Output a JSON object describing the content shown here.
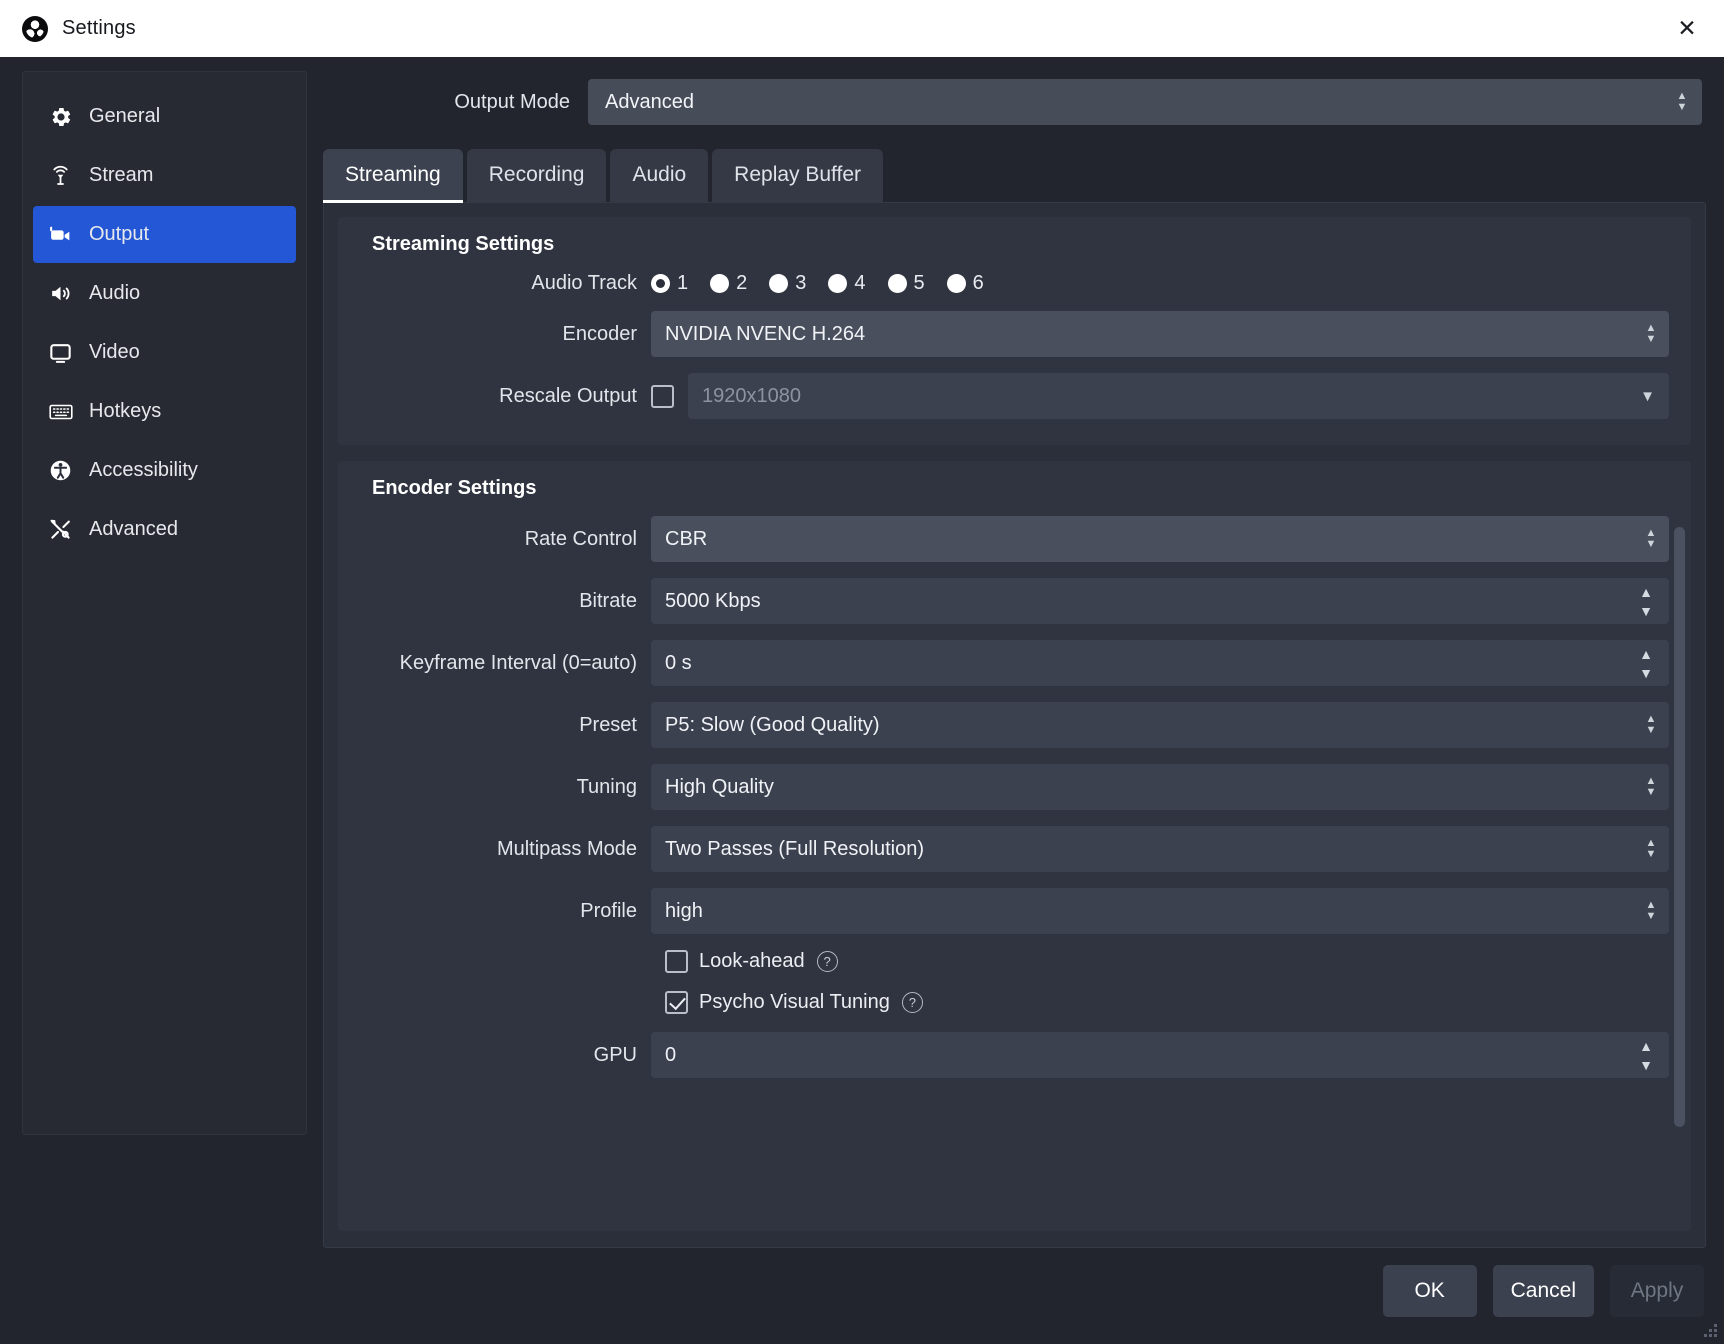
{
  "window": {
    "title": "Settings",
    "close_label": "✕",
    "logo_icon": "obs-logo"
  },
  "sidebar": {
    "items": [
      {
        "label": "General",
        "icon": "gear-icon",
        "active": false
      },
      {
        "label": "Stream",
        "icon": "broadcast-icon",
        "active": false
      },
      {
        "label": "Output",
        "icon": "camera-icon",
        "active": true
      },
      {
        "label": "Audio",
        "icon": "speaker-icon",
        "active": false
      },
      {
        "label": "Video",
        "icon": "monitor-icon",
        "active": false
      },
      {
        "label": "Hotkeys",
        "icon": "keyboard-icon",
        "active": false
      },
      {
        "label": "Accessibility",
        "icon": "accessibility-icon",
        "active": false
      },
      {
        "label": "Advanced",
        "icon": "tools-icon",
        "active": false
      }
    ]
  },
  "output_mode": {
    "label": "Output Mode",
    "value": "Advanced"
  },
  "tabs": [
    {
      "label": "Streaming",
      "active": true
    },
    {
      "label": "Recording",
      "active": false
    },
    {
      "label": "Audio",
      "active": false
    },
    {
      "label": "Replay Buffer",
      "active": false
    }
  ],
  "streaming_settings": {
    "title": "Streaming Settings",
    "audio_track": {
      "label": "Audio Track",
      "options": [
        "1",
        "2",
        "3",
        "4",
        "5",
        "6"
      ],
      "selected": "1"
    },
    "encoder": {
      "label": "Encoder",
      "value": "NVIDIA NVENC H.264"
    },
    "rescale_output": {
      "label": "Rescale Output",
      "checked": false,
      "value": "1920x1080"
    }
  },
  "encoder_settings": {
    "title": "Encoder Settings",
    "rate_control": {
      "label": "Rate Control",
      "value": "CBR"
    },
    "bitrate": {
      "label": "Bitrate",
      "value": "5000 Kbps"
    },
    "keyframe_interval": {
      "label": "Keyframe Interval (0=auto)",
      "value": "0 s"
    },
    "preset": {
      "label": "Preset",
      "value": "P5: Slow (Good Quality)"
    },
    "tuning": {
      "label": "Tuning",
      "value": "High Quality"
    },
    "multipass_mode": {
      "label": "Multipass Mode",
      "value": "Two Passes (Full Resolution)"
    },
    "profile": {
      "label": "Profile",
      "value": "high"
    },
    "look_ahead": {
      "label": "Look-ahead",
      "checked": false,
      "help": "?"
    },
    "psycho_visual_tuning": {
      "label": "Psycho Visual Tuning",
      "checked": true,
      "help": "?"
    },
    "gpu": {
      "label": "GPU",
      "value": "0"
    }
  },
  "footer": {
    "ok_label": "OK",
    "cancel_label": "Cancel",
    "apply_label": "Apply",
    "apply_disabled": true
  },
  "colors": {
    "accent": "#2457d6",
    "titlebar_bg": "#ffffff",
    "panel_bg": "#2b2f3a",
    "field_bg": "#3c4150",
    "field_hl": "#4a4f5d"
  }
}
